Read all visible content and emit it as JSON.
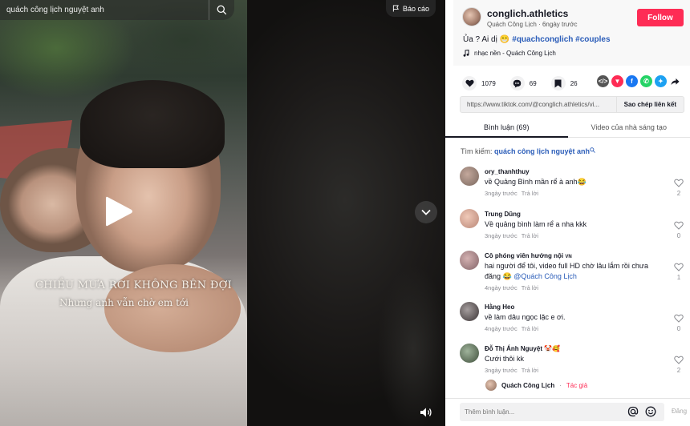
{
  "video": {
    "search_text": "quách công lịch nguyệt anh",
    "report_label": "Báo cáo",
    "caption_line1": "CHIỀU MƯA RƠI KHÔNG BÊN ĐỢI",
    "caption_line2": "Nhưng anh vẫn chờ em tới"
  },
  "author": {
    "username": "conglich.athletics",
    "display_name": "Quách Công Lịch",
    "separator": "·",
    "posted": "6ngày trước",
    "follow_label": "Follow"
  },
  "post": {
    "description_prefix": "Ủa ? Ai dị",
    "emoji": "😁",
    "hashtags": "#quachconglich #couples",
    "music": "nhạc nền - Quách Công Lịch"
  },
  "stats": {
    "likes": "1079",
    "comments": "69",
    "saves": "26"
  },
  "share": {
    "link": "https://www.tiktok.com/@conglich.athletics/vi...",
    "copy_label": "Sao chép liên kết"
  },
  "tabs": {
    "comments": "Bình luận (69)",
    "creator_videos": "Video của nhà sáng tạo"
  },
  "search_suggestion": {
    "prefix": "Tìm kiếm:",
    "keyword": "quách công lịch nguyệt anh"
  },
  "comments": [
    {
      "name": "ory_thanhthuy",
      "text": "về Quảng Bình mần rể à anh😂",
      "time": "3ngày trước",
      "reply": "Trả lời",
      "likes": "2",
      "avatar_color": "#8f7a70"
    },
    {
      "name": "Trung Dũng",
      "text": "Về quảng bình làm rể a nha kkk",
      "time": "3ngày trước",
      "reply": "Trả lời",
      "likes": "0",
      "avatar_color": "#c99a8a"
    },
    {
      "name": "Cô phóng viên hướng nội",
      "name_suffix": "VN",
      "text": "hai người để tôi, video full HD chờ lâu lắm rồi chưa đăng 😂",
      "mention": "@Quách Công Lịch",
      "time": "4ngày trước",
      "reply": "Trả lời",
      "likes": "1",
      "avatar_color": "#9b7b7e"
    },
    {
      "name": "Hằng Heo",
      "text": "về làm dâu ngọc lặc e ơi.",
      "time": "4ngày trước",
      "reply": "Trả lời",
      "likes": "0",
      "avatar_color": "#777071"
    },
    {
      "name": "Đỗ Thị Ánh Nguyệt",
      "name_suffix": "🤡🥰",
      "text": "Cưới thôi kk",
      "time": "3ngày trước",
      "reply": "Trả lời",
      "likes": "2",
      "avatar_color": "#5c6d58"
    }
  ],
  "sub_reply": {
    "name": "Quách Công Lịch",
    "separator": "·",
    "tag": "Tác giả"
  },
  "input": {
    "placeholder": "Thêm bình luận...",
    "post_label": "Đăng"
  },
  "colors": {
    "brand": "#fe2c55",
    "link": "#2b5db9",
    "text": "#161823"
  }
}
